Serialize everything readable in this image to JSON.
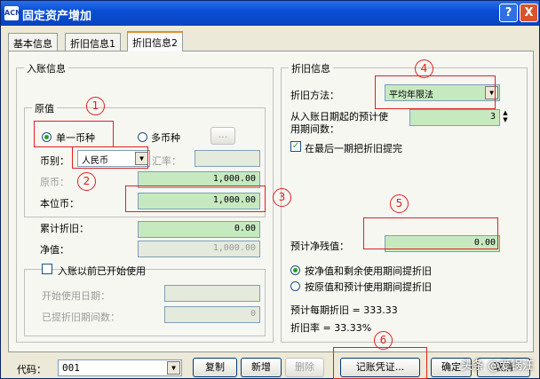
{
  "window": {
    "title": "固定资产增加",
    "app_icon": "ACN",
    "help_label": "?",
    "close_label": "X"
  },
  "tabs": [
    {
      "label": "基本信息"
    },
    {
      "label": "折旧信息1"
    },
    {
      "label": "折旧信息2"
    }
  ],
  "entry": {
    "group_label": "入账信息",
    "original_label": "原值",
    "single_currency": "单一币种",
    "multi_currency": "多币种",
    "currency_label": "币别：",
    "currency_value": "人民币",
    "rate_label": "汇率：",
    "rate_value": "",
    "orig_amount_label": "原币：",
    "orig_amount_value": "1,000.00",
    "local_label": "本位币：",
    "local_value": "1,000.00",
    "accum_dep_label": "累计折旧：",
    "accum_dep_value": "0.00",
    "net_label": "净值：",
    "net_value": "1,000.00",
    "started_label": "入账以前已开始使用",
    "start_date_label": "开始使用日期：",
    "start_date_value": "",
    "periods_label": "已提折旧期间数：",
    "periods_value": "0"
  },
  "depreciation": {
    "group_label": "折旧信息",
    "method_label": "折旧方法：",
    "method_value": "平均年限法",
    "life_label_1": "从入账日期起的预计使",
    "life_label_2": "用期间数：",
    "life_value": "3",
    "last_period_label": "在最后一期把折旧提完",
    "residual_label": "预计净残值：",
    "residual_value": "0.00",
    "opt_net": "按净值和剩余使用期间提折旧",
    "opt_orig": "按原值和预计使用期间提折旧",
    "per_period_label": "预计每期折旧 = 333.33",
    "rate_label": "折旧率 = 33.33%"
  },
  "footer": {
    "code_label": "代码：",
    "code_value": "001",
    "copy": "复制",
    "add": "新增",
    "delete": "删除",
    "voucher": "记账凭证...",
    "ok": "确定",
    "cancel": "取消"
  },
  "annotations": [
    "1",
    "2",
    "3",
    "4",
    "5",
    "6"
  ],
  "watermark": "头条 @爱锅汪",
  "colors": {
    "field_green": "#c7e9c0",
    "annotation_red": "#e02020",
    "title_blue": "#0a4fd4"
  }
}
